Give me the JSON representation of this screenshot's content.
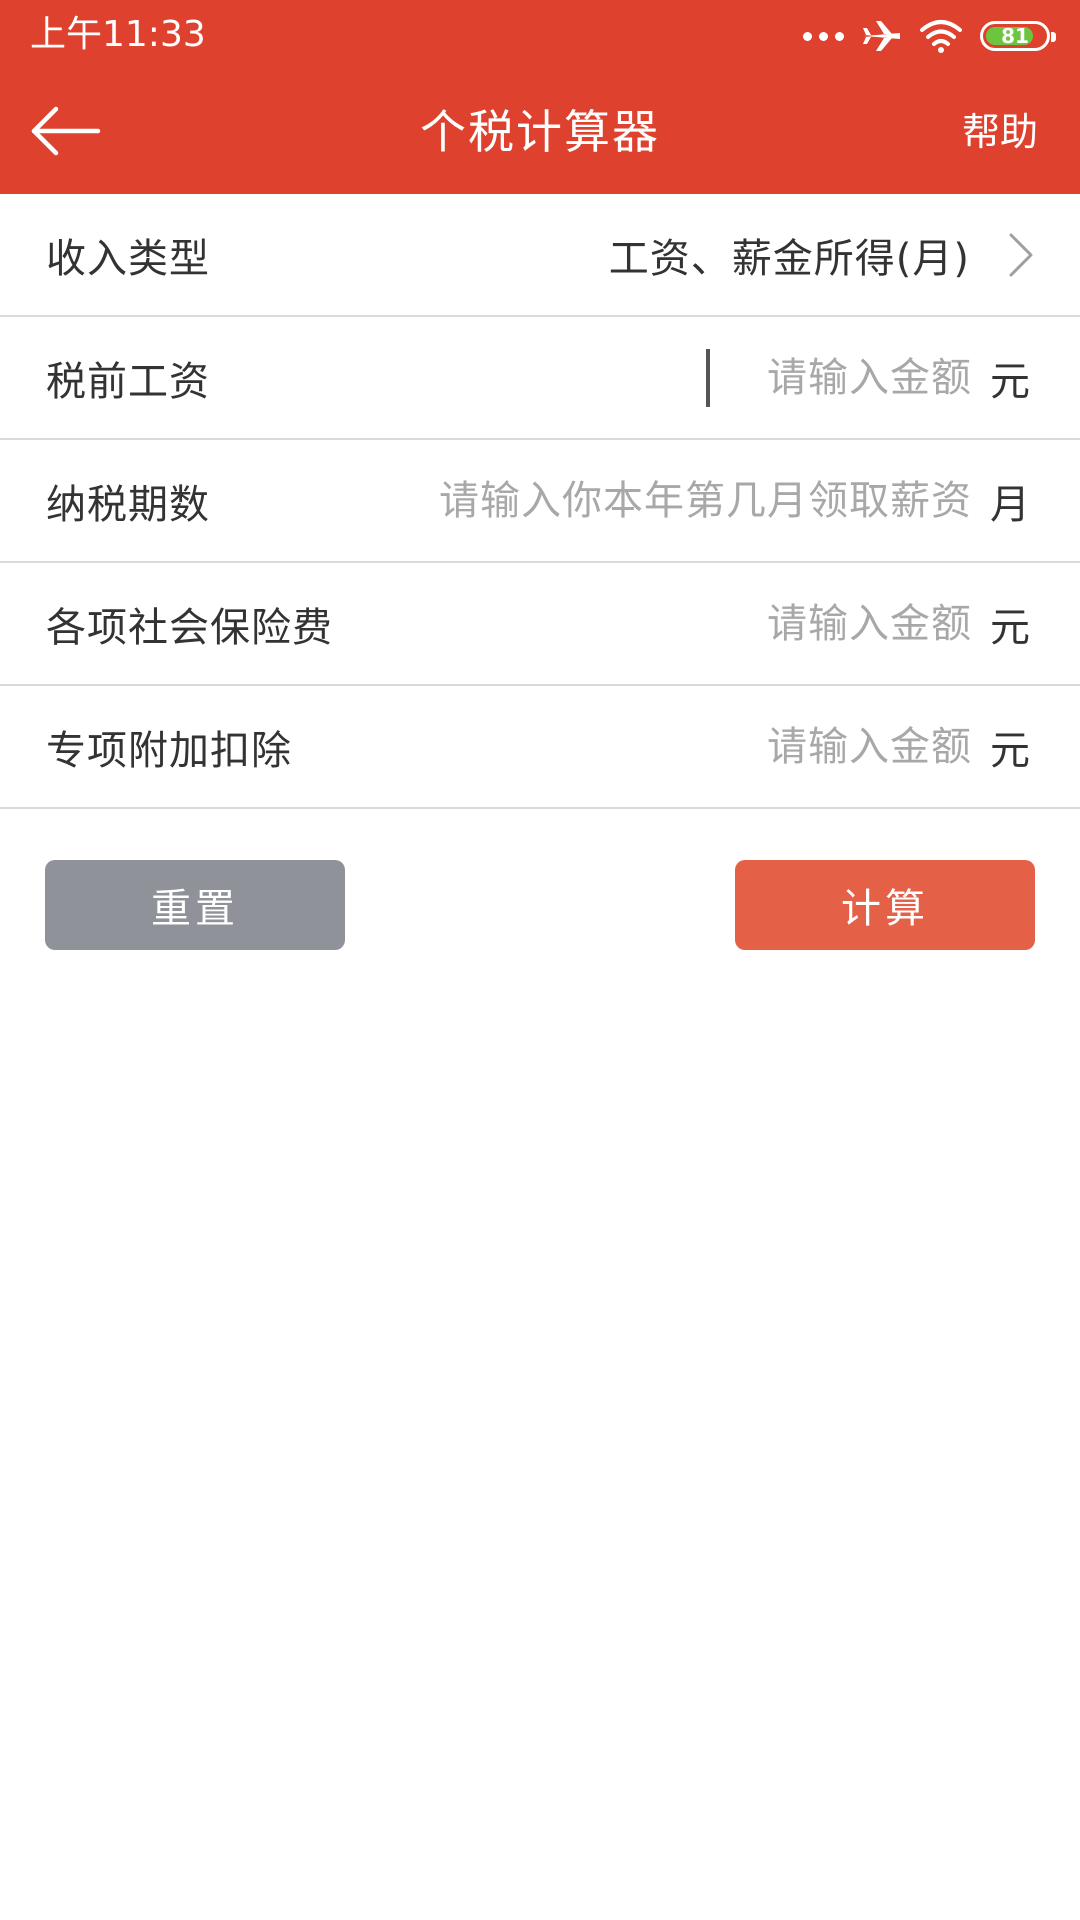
{
  "status_bar": {
    "time": "上午11:33",
    "battery_level": "81",
    "battery_fraction": 0.81
  },
  "nav": {
    "title": "个税计算器",
    "help_label": "帮助"
  },
  "form": {
    "income_type": {
      "label": "收入类型",
      "value": "工资、薪金所得(月)"
    },
    "pre_tax_salary": {
      "label": "税前工资",
      "placeholder": "请输入金额",
      "unit": "元"
    },
    "tax_period": {
      "label": "纳税期数",
      "placeholder": "请输入你本年第几月领取薪资",
      "unit": "月"
    },
    "social_insurance": {
      "label": "各项社会保险费",
      "placeholder": "请输入金额",
      "unit": "元"
    },
    "special_deduction": {
      "label": "专项附加扣除",
      "placeholder": "请输入金额",
      "unit": "元"
    }
  },
  "buttons": {
    "reset_label": "重置",
    "calculate_label": "计算"
  },
  "colors": {
    "header": "#de412d",
    "reset_button": "#8f9299",
    "calculate_button": "#e46047",
    "battery_fill": "#6cc53f"
  }
}
